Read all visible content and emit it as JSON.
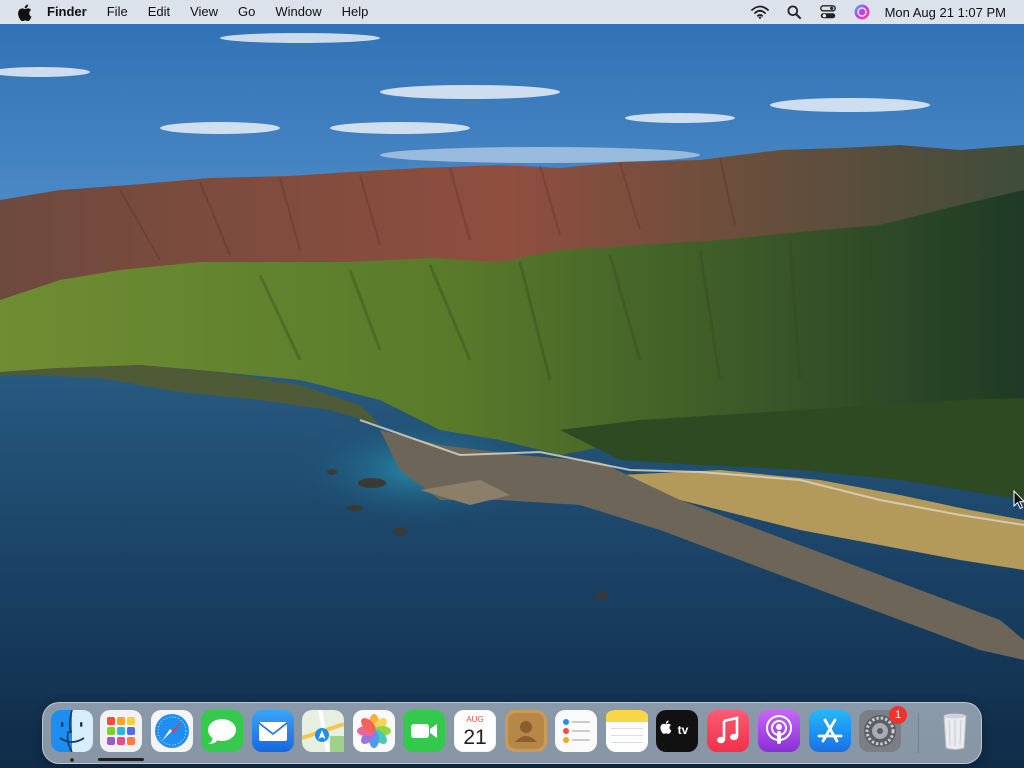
{
  "menubar": {
    "app_name": "Finder",
    "menus": [
      "File",
      "Edit",
      "View",
      "Go",
      "Window",
      "Help"
    ],
    "clock": "Mon Aug 21  1:07 PM"
  },
  "dock": {
    "apps": [
      {
        "name": "Finder",
        "icon": "finder-icon",
        "running": true
      },
      {
        "name": "Launchpad",
        "icon": "launchpad-icon"
      },
      {
        "name": "Safari",
        "icon": "safari-icon"
      },
      {
        "name": "Messages",
        "icon": "messages-icon"
      },
      {
        "name": "Mail",
        "icon": "mail-icon"
      },
      {
        "name": "Maps",
        "icon": "maps-icon"
      },
      {
        "name": "Photos",
        "icon": "photos-icon"
      },
      {
        "name": "FaceTime",
        "icon": "facetime-icon"
      },
      {
        "name": "Calendar",
        "icon": "calendar-icon"
      },
      {
        "name": "Contacts",
        "icon": "contacts-icon"
      },
      {
        "name": "Reminders",
        "icon": "reminders-icon"
      },
      {
        "name": "Notes",
        "icon": "notes-icon"
      },
      {
        "name": "TV",
        "icon": "apple-tv-icon"
      },
      {
        "name": "Music",
        "icon": "music-icon"
      },
      {
        "name": "Podcasts",
        "icon": "podcasts-icon"
      },
      {
        "name": "App Store",
        "icon": "app-store-icon"
      },
      {
        "name": "System Preferences",
        "icon": "system-preferences-icon"
      },
      {
        "name": "Trash",
        "icon": "trash-icon"
      }
    ],
    "calendar_month": "AUG",
    "calendar_day": "21",
    "tv_label": "tv",
    "system_preferences_badge": "1"
  },
  "colors": {
    "sky_top": "#2f73b8",
    "ocean": "#173c5e",
    "mountain_green": "#5f7a2e",
    "mountain_red": "#8a4a3c"
  }
}
